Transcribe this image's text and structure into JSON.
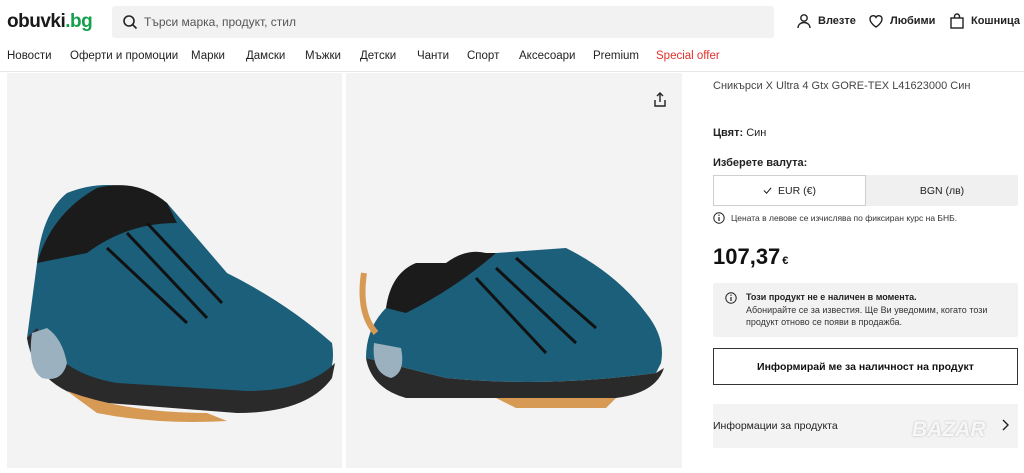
{
  "header": {
    "logo_main": "obuvki",
    "logo_tld": ".bg",
    "search_placeholder": "Търси марка, продукт, стил",
    "login_label": "Влезте",
    "favorites_label": "Любими",
    "cart_label": "Кошница"
  },
  "nav": {
    "items": [
      "Новости",
      "Оферти и промоции",
      "Марки",
      "Дамски",
      "Мъжки",
      "Детски",
      "Чанти",
      "Спорт",
      "Аксесоари",
      "Premium"
    ],
    "special": "Special offer"
  },
  "product": {
    "subtitle": "Сникърси X Ultra 4 Gtx GORE-TEX L41623000 Син",
    "color_label": "Цвят:",
    "color_value": "Син",
    "currency_label": "Изберете валута:",
    "currency_options": [
      "EUR (€)",
      "BGN (лв)"
    ],
    "currency_selected": "EUR (€)",
    "currency_note": "Цената в левове се изчислява по фиксиран курс на БНБ.",
    "price": "107,37",
    "price_currency": "€",
    "stock_title": "Този продукт не е наличен в момента.",
    "stock_text": "Абонирайте се за известия. Ще Ви уведомим, когато този продукт отново се появи в продажба.",
    "notify_button": "Информирай ме за наличност на продукт",
    "info_section": "Информации за продукта"
  },
  "watermark": "BAZAR",
  "colors": {
    "brand_green": "#14a14b",
    "special_red": "#e0312a",
    "shoe_blue": "#1b5f7a"
  }
}
